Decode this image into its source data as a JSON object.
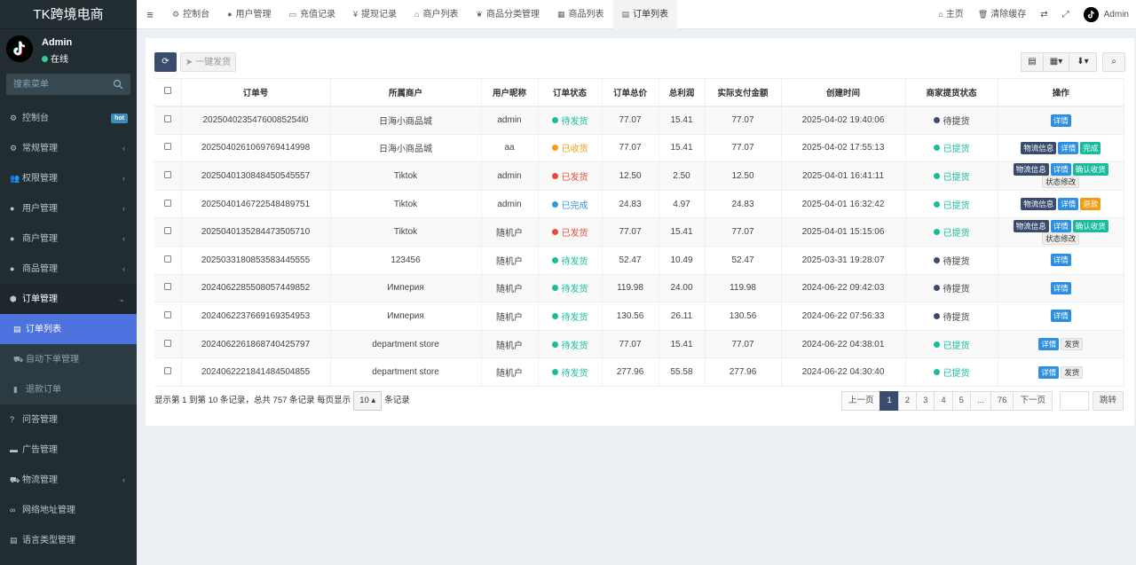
{
  "brand": "TK跨境电商",
  "user": {
    "name": "Admin",
    "status": "在线"
  },
  "search": {
    "placeholder": "搜索菜单"
  },
  "menu": [
    {
      "icon": "dashboard-icon",
      "glyph": "⚙",
      "label": "控制台",
      "badge": "hot"
    },
    {
      "icon": "cogs-icon",
      "glyph": "⚙",
      "label": "常规管理",
      "caret": true
    },
    {
      "icon": "users-icon",
      "glyph": "👥",
      "label": "权限管理",
      "caret": true
    },
    {
      "icon": "user-icon",
      "glyph": "●",
      "label": "用户管理",
      "caret": true
    },
    {
      "icon": "apple-icon",
      "glyph": "●",
      "label": "商户管理",
      "caret": true
    },
    {
      "icon": "product-icon",
      "glyph": "●",
      "label": "商品管理",
      "caret": true
    },
    {
      "icon": "order-icon",
      "glyph": "⬢",
      "label": "订单管理",
      "caret": true,
      "open": true
    }
  ],
  "submenu": [
    {
      "icon": "list-icon",
      "glyph": "▤",
      "label": "订单列表",
      "active": true
    },
    {
      "icon": "car-icon",
      "glyph": "⛟",
      "label": "自动下单管理"
    },
    {
      "icon": "refund-icon",
      "glyph": "▮",
      "label": "退款订单"
    }
  ],
  "menu2": [
    {
      "icon": "question-icon",
      "glyph": "?",
      "label": "问答管理"
    },
    {
      "icon": "ad-icon",
      "glyph": "▬",
      "label": "广告管理"
    },
    {
      "icon": "truck-icon",
      "glyph": "⛟",
      "label": "物流管理",
      "caret": true
    },
    {
      "icon": "link-icon",
      "glyph": "∞",
      "label": "网络地址管理"
    },
    {
      "icon": "language-icon",
      "glyph": "▤",
      "label": "语言类型管理"
    }
  ],
  "tabs": [
    {
      "icon": "dashboard-icon",
      "glyph": "⚙",
      "label": "控制台"
    },
    {
      "icon": "user-icon",
      "glyph": "●",
      "label": "用户管理"
    },
    {
      "icon": "recharge-icon",
      "glyph": "▭",
      "label": "充值记录"
    },
    {
      "icon": "yen-icon",
      "glyph": "¥",
      "label": "提现记录"
    },
    {
      "icon": "home-icon",
      "glyph": "⌂",
      "label": "商户列表"
    },
    {
      "icon": "leaf-icon",
      "glyph": "❦",
      "label": "商品分类管理"
    },
    {
      "icon": "shop-icon",
      "glyph": "▦",
      "label": "商品列表"
    },
    {
      "icon": "list-icon",
      "glyph": "▤",
      "label": "订单列表",
      "active": true
    }
  ],
  "topright": {
    "home": "主页",
    "clear_cache": "清除缓存",
    "admin": "Admin"
  },
  "toolbar": {
    "ship_label": "一键发货"
  },
  "table": {
    "headers": [
      "订单号",
      "所属商户",
      "用户昵称",
      "订单状态",
      "订单总价",
      "总利润",
      "实际支付金额",
      "创建时间",
      "商家提货状态",
      "操作"
    ],
    "rows": [
      {
        "id": "20250402354760085254l0",
        "shop": "日海小商品城",
        "user": "admin",
        "status": "待发货",
        "total": "77.07",
        "profit": "15.41",
        "paid": "77.07",
        "time": "2025-04-02 19:40:06",
        "pickup": "待提货",
        "actions": [
          "详情"
        ]
      },
      {
        "id": "2025040261069769414998",
        "shop": "日海小商品城",
        "user": "aa",
        "status": "已收货",
        "total": "77.07",
        "profit": "15.41",
        "paid": "77.07",
        "time": "2025-04-02 17:55:13",
        "pickup": "已提货",
        "actions": [
          "物流信息",
          "详情",
          "完成"
        ]
      },
      {
        "id": "2025040130848450545557",
        "shop": "Tiktok",
        "user": "admin",
        "status": "已发货",
        "total": "12.50",
        "profit": "2.50",
        "paid": "12.50",
        "time": "2025-04-01 16:41:11",
        "pickup": "已提货",
        "actions": [
          "物流信息",
          "详情",
          "确认收货",
          "状态修改"
        ]
      },
      {
        "id": "2025040146722548489751",
        "shop": "Tiktok",
        "user": "admin",
        "status": "已完成",
        "total": "24.83",
        "profit": "4.97",
        "paid": "24.83",
        "time": "2025-04-01 16:32:42",
        "pickup": "已提货",
        "actions": [
          "物流信息",
          "详情",
          "退款"
        ]
      },
      {
        "id": "2025040135284473505710",
        "shop": "Tiktok",
        "user": "随机户",
        "status": "已发货",
        "total": "77.07",
        "profit": "15.41",
        "paid": "77.07",
        "time": "2025-04-01 15:15:06",
        "pickup": "已提货",
        "actions": [
          "物流信息",
          "详情",
          "确认收货",
          "状态修改"
        ]
      },
      {
        "id": "2025033180853583445555",
        "shop": "123456",
        "user": "随机户",
        "status": "待发货",
        "total": "52.47",
        "profit": "10.49",
        "paid": "52.47",
        "time": "2025-03-31 19:28:07",
        "pickup": "待提货",
        "actions": [
          "详情"
        ]
      },
      {
        "id": "2024062285508057449852",
        "shop": "Империя",
        "user": "随机户",
        "status": "待发货",
        "total": "119.98",
        "profit": "24.00",
        "paid": "119.98",
        "time": "2024-06-22 09:42:03",
        "pickup": "待提货",
        "actions": [
          "详情"
        ]
      },
      {
        "id": "2024062237669169354953",
        "shop": "Империя",
        "user": "随机户",
        "status": "待发货",
        "total": "130.56",
        "profit": "26.11",
        "paid": "130.56",
        "time": "2024-06-22 07:56:33",
        "pickup": "待提货",
        "actions": [
          "详情"
        ]
      },
      {
        "id": "2024062261868740425797",
        "shop": "department store",
        "user": "随机户",
        "status": "待发货",
        "total": "77.07",
        "profit": "15.41",
        "paid": "77.07",
        "time": "2024-06-22 04:38:01",
        "pickup": "已提货",
        "actions": [
          "详情",
          "发货"
        ]
      },
      {
        "id": "2024062221841484504855",
        "shop": "department store",
        "user": "随机户",
        "status": "待发货",
        "total": "277.96",
        "profit": "55.58",
        "paid": "277.96",
        "time": "2024-06-22 04:30:40",
        "pickup": "已提货",
        "actions": [
          "详情",
          "发货"
        ]
      }
    ]
  },
  "footer": {
    "summary": "显示第 1 到第 10 条记录，总共 757 条记录 每页显示",
    "page_size": "10",
    "suffix": "条记录"
  },
  "pager": {
    "prev": "上一页",
    "pages": [
      "1",
      "2",
      "3",
      "4",
      "5",
      "...",
      "76"
    ],
    "next": "下一页",
    "go": "跳转"
  },
  "colors": {
    "待发货": "#18bc9c",
    "已收货": "#f39c12",
    "已发货": "#e74c3c",
    "已完成": "#3498db",
    "待提货": "#3a4c6d",
    "已提货": "#18bc9c",
    "物流信息": "#3a4c6d",
    "详情": "#2c8fe0",
    "完成": "#18bc9c",
    "确认收货": "#18bc9c",
    "退款": "#f39c12",
    "状态修改": "#eeeeee",
    "发货": "#eeeeee"
  }
}
